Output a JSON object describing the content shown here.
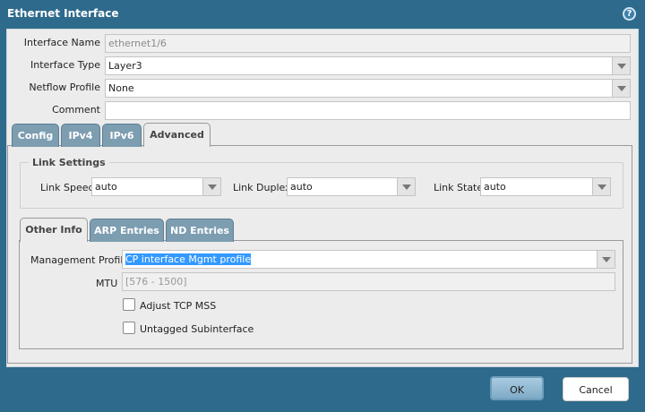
{
  "dialog": {
    "title": "Ethernet Interface",
    "help_icon": "help-icon"
  },
  "fields": {
    "interface_name": {
      "label": "Interface Name",
      "value": "ethernet1/6"
    },
    "interface_type": {
      "label": "Interface Type",
      "value": "Layer3"
    },
    "netflow_profile": {
      "label": "Netflow Profile",
      "value": "None"
    },
    "comment": {
      "label": "Comment",
      "value": ""
    }
  },
  "tabs": [
    {
      "label": "Config"
    },
    {
      "label": "IPv4"
    },
    {
      "label": "IPv6"
    },
    {
      "label": "Advanced",
      "active": true
    }
  ],
  "link_settings": {
    "legend": "Link Settings",
    "speed": {
      "label": "Link Speed",
      "value": "auto"
    },
    "duplex": {
      "label": "Link Duplex",
      "value": "auto"
    },
    "state": {
      "label": "Link State",
      "value": "auto"
    }
  },
  "sub_tabs": [
    {
      "label": "Other Info",
      "active": true
    },
    {
      "label": "ARP Entries"
    },
    {
      "label": "ND Entries"
    }
  ],
  "other_info": {
    "management_profile": {
      "label": "Management Profile",
      "value": "CP interface Mgmt profile"
    },
    "mtu": {
      "label": "MTU",
      "placeholder": "[576 - 1500]"
    },
    "adjust_tcp_mss": {
      "label": "Adjust TCP MSS",
      "checked": false
    },
    "untagged_subinterface": {
      "label": "Untagged Subinterface",
      "checked": false
    }
  },
  "buttons": {
    "ok": "OK",
    "cancel": "Cancel"
  }
}
